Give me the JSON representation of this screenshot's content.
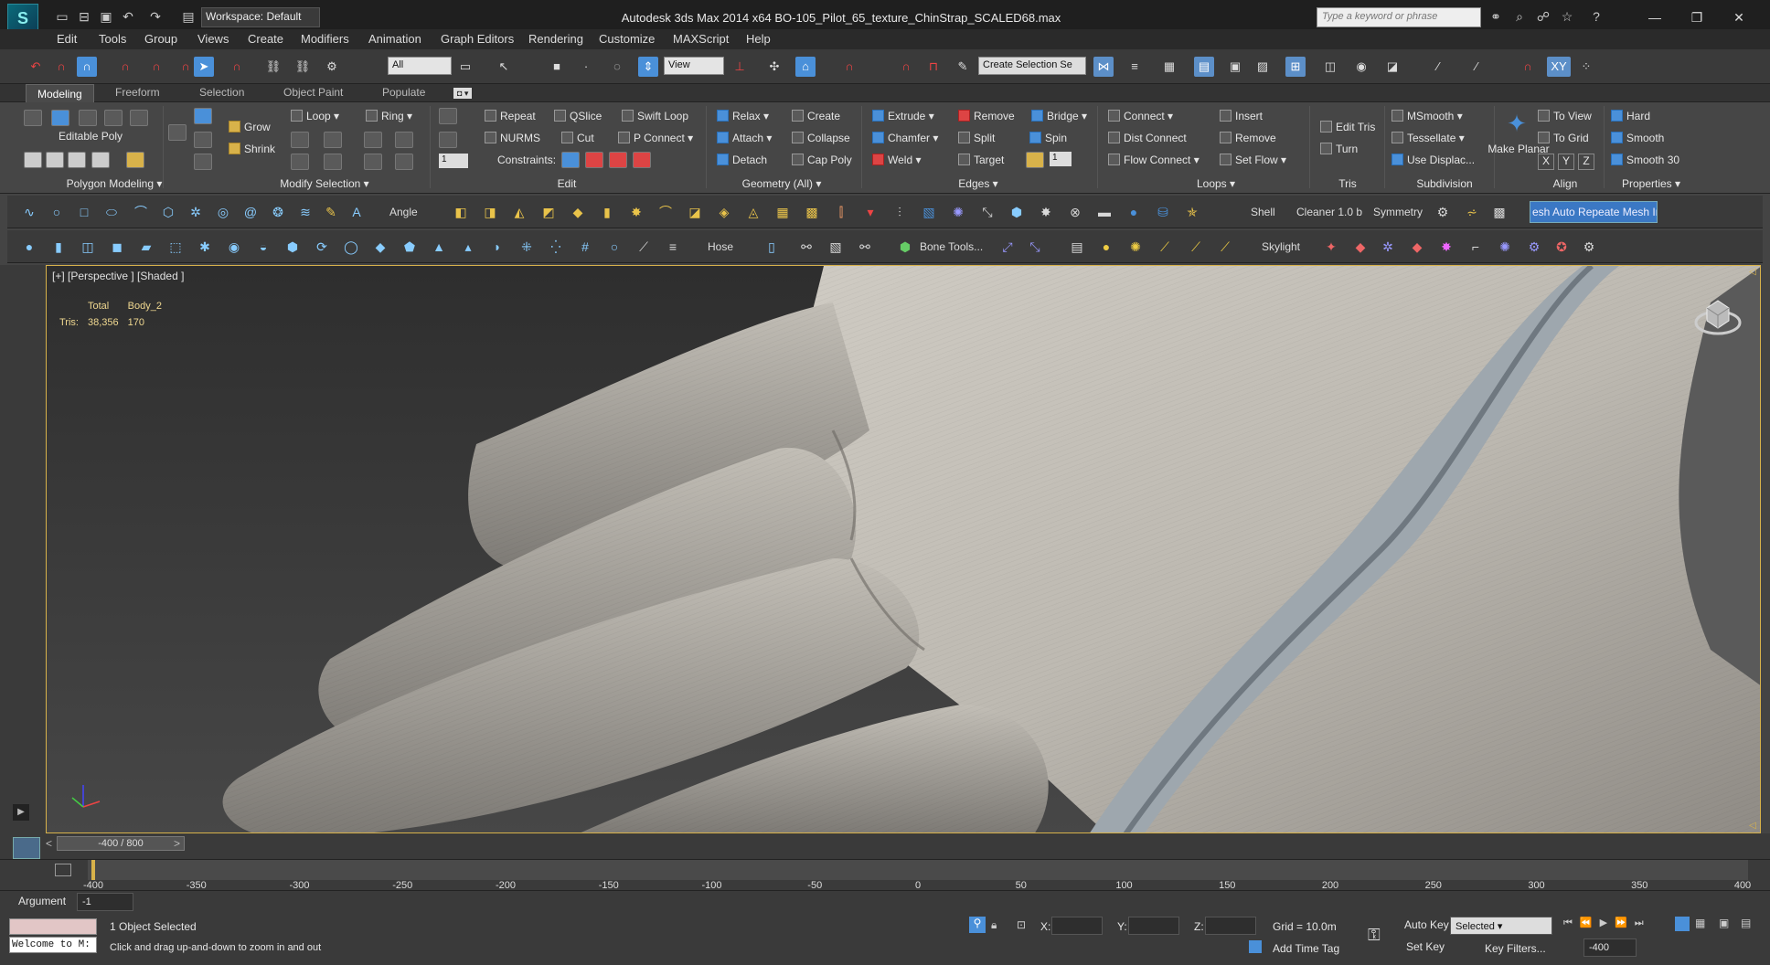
{
  "titlebar": {
    "workspace": "Workspace: Default",
    "title": "Autodesk 3ds Max  2014 x64     BO-105_Pilot_65_texture_ChinStrap_SCALED68.max",
    "search_placeholder": "Type a keyword or phrase"
  },
  "menu": [
    "Edit",
    "Tools",
    "Group",
    "Views",
    "Create",
    "Modifiers",
    "Animation",
    "Graph Editors",
    "Rendering",
    "Customize",
    "MAXScript",
    "Help"
  ],
  "maintoolbar": {
    "filter": "All",
    "refcoord": "View",
    "selset": "Create Selection Se",
    "xy_label": "XY"
  },
  "ribbon_tabs": [
    "Modeling",
    "Freeform",
    "Selection",
    "Object Paint",
    "Populate"
  ],
  "ribbon": {
    "poly_label": "Editable Poly",
    "polygon_modeling": "Polygon Modeling",
    "modify_selection": "Modify Selection",
    "grow": "Grow",
    "shrink": "Shrink",
    "loop": "Loop",
    "ring": "Ring",
    "edit_group": "Edit",
    "repeat": "Repeat",
    "qslice": "QSlice",
    "swift_loop": "Swift Loop",
    "nurms": "NURMS",
    "cut": "Cut",
    "p_connect": "P Connect",
    "constraints": "Constraints:",
    "constraint_value": "1",
    "geometry_all": "Geometry (All)",
    "relax": "Relax",
    "create": "Create",
    "attach": "Attach",
    "collapse": "Collapse",
    "detach": "Detach",
    "cap_poly": "Cap Poly",
    "edges": "Edges",
    "extrude": "Extrude",
    "remove": "Remove",
    "bridge": "Bridge",
    "chamfer": "Chamfer",
    "split": "Split",
    "spin": "Spin",
    "weld": "Weld",
    "target": "Target",
    "spin_value": "1",
    "loops": "Loops",
    "connect": "Connect",
    "insert": "Insert",
    "dist_connect": "Dist Connect",
    "loops_remove": "Remove",
    "flow_connect": "Flow Connect",
    "set_flow": "Set Flow",
    "tris": "Tris",
    "edit_tris": "Edit Tris",
    "turn": "Turn",
    "subdivision": "Subdivision",
    "msmooth": "MSmooth",
    "tessellate": "Tessellate",
    "use_displac": "Use Displac...",
    "make_planar": "Make Planar",
    "align": "Align",
    "to_view": "To View",
    "to_grid": "To Grid",
    "ax_x": "X",
    "ax_y": "Y",
    "ax_z": "Z",
    "properties": "Properties",
    "hard": "Hard",
    "smooth": "Smooth",
    "smooth30": "Smooth 30"
  },
  "toolbar2": {
    "angle": "Angle",
    "shell": "Shell",
    "cleaner": "Cleaner 1.0 b",
    "symmetry": "Symmetry",
    "mesh_btn": "esh Auto Repeate Mesh Insp"
  },
  "toolbar3": {
    "hose": "Hose",
    "bone_tools": "Bone Tools...",
    "skylight": "Skylight"
  },
  "viewport": {
    "label": "[+] [Perspective ] [Shaded ]",
    "stats": {
      "col1": "Total",
      "col2": "Body_2",
      "row_label": "Tris:",
      "total": "38,356",
      "body": "170"
    }
  },
  "timeline": {
    "frame": "-400 / 800",
    "ticks": [
      "-400",
      "-350",
      "-300",
      "-250",
      "-200",
      "-150",
      "-100",
      "-50",
      "0",
      "50",
      "100",
      "150",
      "200",
      "250",
      "300",
      "350",
      "400"
    ]
  },
  "status": {
    "argument_label": "Argument",
    "argument_value": "-1",
    "welcome": "Welcome to M:",
    "selected": "1 Object Selected",
    "prompt": "Click and drag up-and-down to zoom in and out",
    "x": "X:",
    "y": "Y:",
    "z": "Z:",
    "grid": "Grid = 10.0m",
    "add_time_tag": "Add Time Tag",
    "auto_key": "Auto Key",
    "set_key": "Set Key",
    "key_mode": "Selected",
    "key_filters": "Key Filters...",
    "frame_field": "-400"
  }
}
